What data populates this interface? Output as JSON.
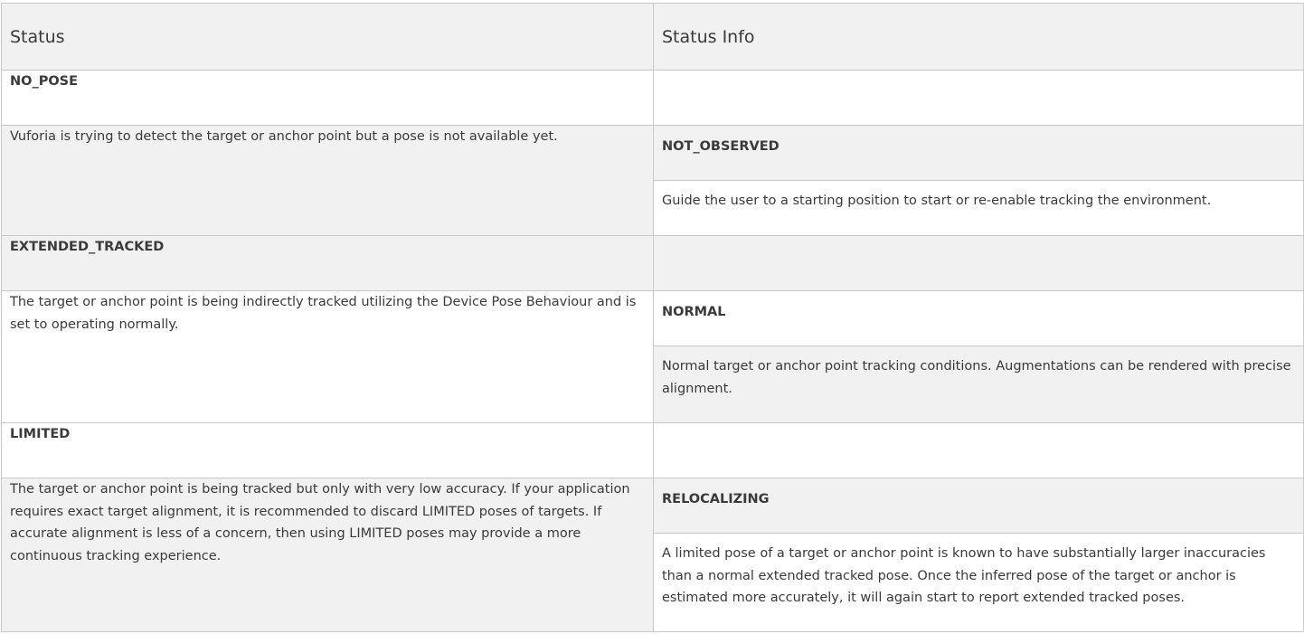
{
  "table": {
    "headers": {
      "status": "Status",
      "status_info": "Status Info"
    },
    "rows": [
      {
        "status_name": "NO_POSE",
        "status_description": "Vuforia is trying to detect the target or anchor point but a pose is not available yet.",
        "info_name": "NOT_OBSERVED",
        "info_description": "Guide the user to a starting position to start or re-enable tracking the environment."
      },
      {
        "status_name": "EXTENDED_TRACKED",
        "status_description": "The target or anchor point is being indirectly tracked utilizing the Device Pose Behaviour and is set to operating normally.",
        "info_name": "NORMAL",
        "info_description": "Normal target or anchor point tracking conditions. Augmentations can be rendered with precise alignment."
      },
      {
        "status_name": "LIMITED",
        "status_description": "The target or anchor point is being tracked but only with very low accuracy. If your application requires exact target alignment, it is recommended to discard LIMITED poses of targets. If accurate alignment is less of a concern, then using LIMITED poses may provide a more continuous tracking experience.",
        "info_name": "RELOCALIZING",
        "info_description": "A limited pose of a target or anchor point is known to have substantially larger inaccuracies than a normal extended tracked pose. Once the inferred pose of the target or anchor is estimated more accurately, it will again start to report extended tracked poses."
      }
    ]
  },
  "colors": {
    "header_bg": "#f1f1f1",
    "row_alt_bg": "#f1f1f1",
    "border": "#c9c9c9",
    "text": "#3a3a3a"
  }
}
